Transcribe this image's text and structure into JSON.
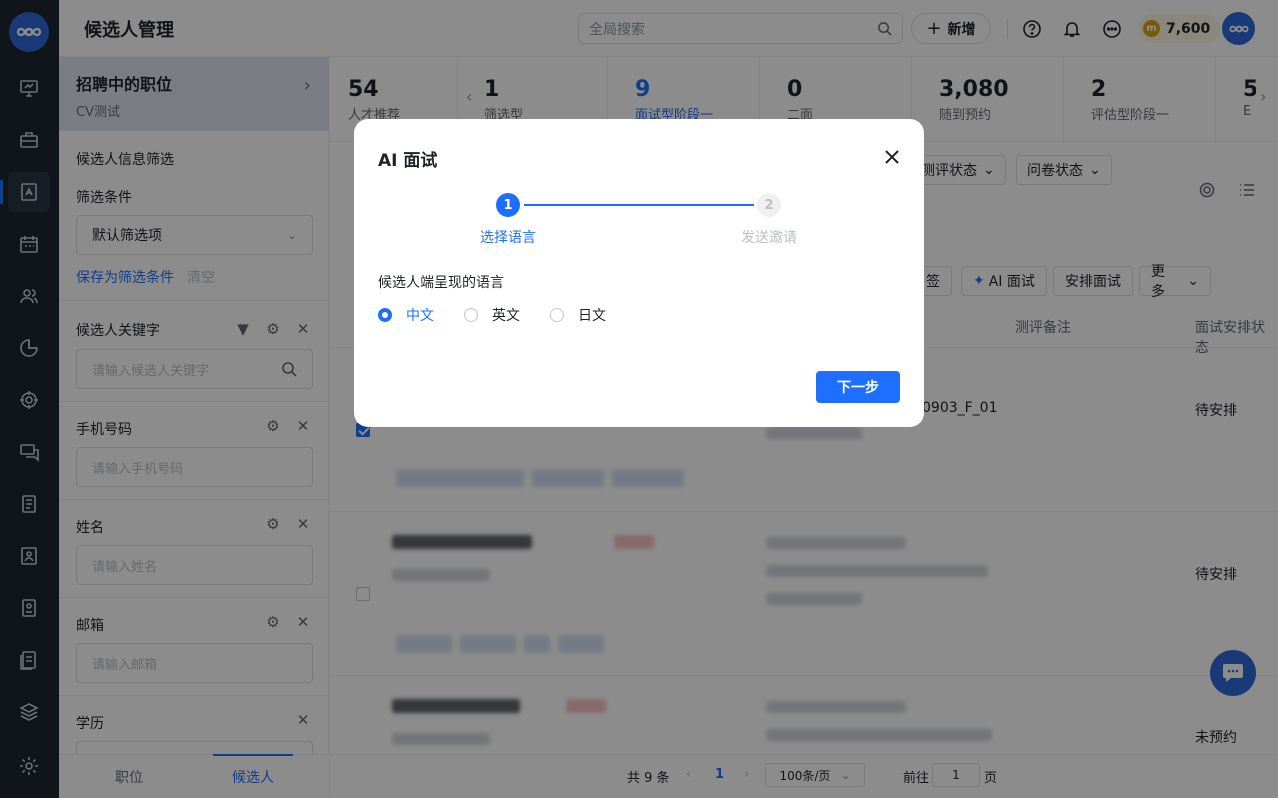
{
  "header": {
    "page_title": "候选人管理",
    "search_placeholder": "全局搜索",
    "new_button": "新增",
    "coins": "7,600",
    "coin_symbol": "m"
  },
  "filter_panel": {
    "job_card_title": "招聘中的职位",
    "job_card_sub": "CV测试",
    "section_title": "候选人信息筛选",
    "conditions_label": "筛选条件",
    "conditions_value": "默认筛选项",
    "save_link": "保存为筛选条件",
    "clear_link": "清空",
    "fields": [
      {
        "label": "候选人关键字",
        "placeholder": "请输入候选人关键字"
      },
      {
        "label": "手机号码",
        "placeholder": "请输入手机号码"
      },
      {
        "label": "姓名",
        "placeholder": "请输入姓名"
      },
      {
        "label": "邮箱",
        "placeholder": "请输入邮箱"
      },
      {
        "label": "学历",
        "placeholder": ""
      }
    ],
    "tabs": [
      "职位",
      "候选人"
    ]
  },
  "stages": [
    {
      "num": "54",
      "label": "人才推荐"
    },
    {
      "num": "1",
      "label": "筛选型"
    },
    {
      "num": "9",
      "label": "面试型阶段一"
    },
    {
      "num": "0",
      "label": "二面"
    },
    {
      "num": "3,080",
      "label": "随到预约"
    },
    {
      "num": "2",
      "label": "评估型阶段一"
    },
    {
      "num": "5",
      "label": "E"
    }
  ],
  "filters": [
    "测评状态",
    "问卷状态"
  ],
  "actions": [
    "签",
    "AI 面试",
    "安排面试",
    "更多"
  ],
  "table": {
    "headers": [
      "测评备注",
      "面试安排状态"
    ],
    "rows": [
      {
        "note": "0903_F_01",
        "status": "待安排"
      },
      {
        "note": "",
        "status": "待安排"
      },
      {
        "note": "",
        "status": "未预约"
      }
    ]
  },
  "pager": {
    "total": "共 9 条",
    "current": "1",
    "page_size": "100条/页",
    "goto_label": "前往",
    "goto_value": "1",
    "page_unit": "页"
  },
  "modal": {
    "title": "AI 面试",
    "steps": [
      {
        "num": "1",
        "label": "选择语言"
      },
      {
        "num": "2",
        "label": "发送邀请"
      }
    ],
    "question": "候选人端呈现的语言",
    "options": [
      "中文",
      "英文",
      "日文"
    ],
    "selected": "中文",
    "next_button": "下一步"
  },
  "colors": {
    "primary": "#1e6fff",
    "rail": "#1e2733"
  }
}
